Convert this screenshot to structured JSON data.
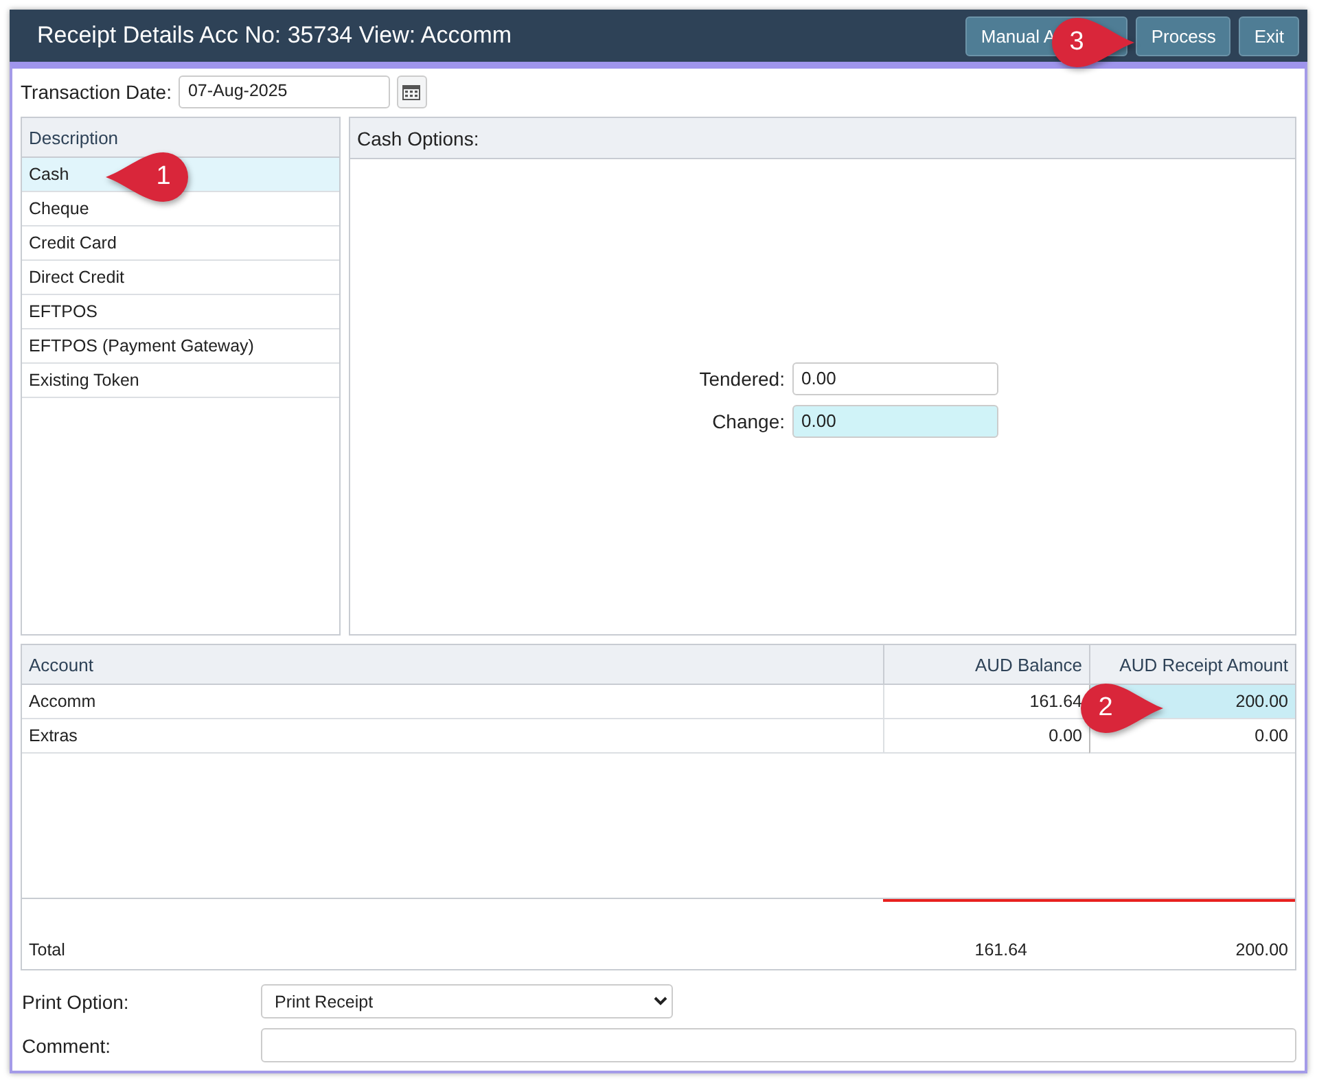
{
  "window": {
    "title": "Receipt Details Acc No: 35734 View: Accomm"
  },
  "toolbar": {
    "buttons": [
      "Manual A",
      "Process",
      "Exit"
    ]
  },
  "transaction_date": {
    "label": "Transaction Date:",
    "value": "07-Aug-2025"
  },
  "payment_methods": {
    "header": "Description",
    "items": [
      {
        "label": "Cash",
        "selected": true
      },
      {
        "label": "Cheque",
        "selected": false
      },
      {
        "label": "Credit Card",
        "selected": false
      },
      {
        "label": "Direct Credit",
        "selected": false
      },
      {
        "label": "EFTPOS",
        "selected": false
      },
      {
        "label": "EFTPOS (Payment Gateway)",
        "selected": false
      },
      {
        "label": "Existing Token",
        "selected": false
      }
    ]
  },
  "cash_options": {
    "title": "Cash Options:",
    "fields": [
      {
        "label": "Tendered:",
        "value": "0.00",
        "readonly": false
      },
      {
        "label": "Change:",
        "value": "0.00",
        "readonly": true
      }
    ]
  },
  "accounts": {
    "columns": [
      "Account",
      "AUD Balance",
      "AUD Receipt Amount"
    ],
    "rows": [
      {
        "account": "Accomm",
        "balance": "161.64",
        "amount": "200.00",
        "selected": true
      },
      {
        "account": "Extras",
        "balance": "0.00",
        "amount": "0.00",
        "selected": false
      }
    ],
    "total": {
      "label": "Total",
      "balance": "161.64",
      "amount": "200.00"
    }
  },
  "print_option": {
    "label": "Print Option:",
    "value": "Print Receipt"
  },
  "comment": {
    "label": "Comment:"
  },
  "callouts": [
    {
      "number": "1",
      "kind": "leftpin"
    },
    {
      "number": "2",
      "kind": "rightpin"
    },
    {
      "number": "3",
      "kind": "rightpin"
    }
  ]
}
